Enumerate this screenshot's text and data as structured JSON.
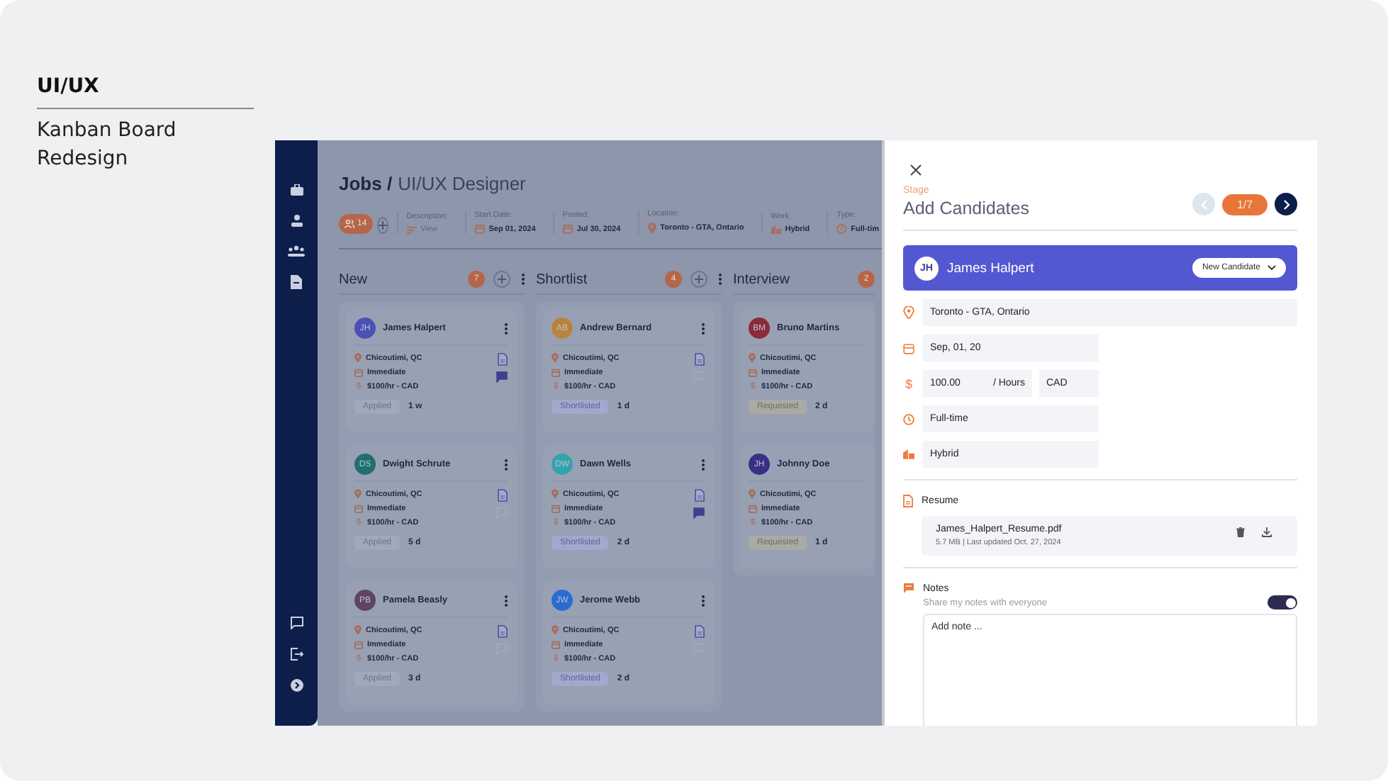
{
  "case_study": {
    "category": "UI/UX",
    "title": "Kanban Board Redesign"
  },
  "job": {
    "breadcrumb": "Jobs /",
    "title": "UI/UX Designer",
    "candidate_count": "14",
    "meta": [
      {
        "kind": "description",
        "label": "Description:",
        "value": "View"
      },
      {
        "kind": "date",
        "label": "Start Date:",
        "value": "Sep 01, 2024"
      },
      {
        "kind": "date",
        "label": "Posted:",
        "value": "Jul 30, 2024"
      },
      {
        "kind": "location",
        "label": "Location:",
        "value": "Toronto - GTA, Ontario"
      },
      {
        "kind": "work",
        "label": "Work:",
        "value": "Hybrid"
      },
      {
        "kind": "type",
        "label": "Type:",
        "value": "Full-tim"
      }
    ]
  },
  "columns": [
    {
      "title": "New",
      "count": "7",
      "cards": [
        {
          "initials": "JH",
          "name": "James Halpert",
          "color": "#4b50b4",
          "location": "Chicoutimi, QC",
          "availability": "Immediate",
          "rate_symbol": "$",
          "rate": "$100/hr - CAD",
          "status": {
            "kind": "applied",
            "text": "Applied"
          },
          "age": "1 w",
          "notes": true
        },
        {
          "initials": "DS",
          "name": "Dwight Schrute",
          "color": "#1f6f6e",
          "location": "Chicoutimi, QC",
          "availability": "Immediate",
          "rate_symbol": "$",
          "rate": "$100/hr - CAD",
          "status": {
            "kind": "applied",
            "text": "Applied"
          },
          "age": "5 d",
          "notes": false
        },
        {
          "initials": "PB",
          "name": "Pamela Beasly",
          "color": "#5e4560",
          "location": "Chicoutimi, QC",
          "availability": "Immediate",
          "rate_symbol": "$",
          "rate": "$100/hr - CAD",
          "status": {
            "kind": "applied",
            "text": "Applied"
          },
          "age": "3 d",
          "notes": false
        }
      ]
    },
    {
      "title": "Shortlist",
      "count": "4",
      "cards": [
        {
          "initials": "AB",
          "name": "Andrew Bernard",
          "color": "#b9843a",
          "location": "Chicoutimi, QC",
          "availability": "Immediate",
          "rate_symbol": "$",
          "rate": "$100/hr - CAD",
          "status": {
            "kind": "shortlisted",
            "text": "Shortlisted"
          },
          "age": "1 d",
          "notes": false
        },
        {
          "initials": "DW",
          "name": "Dawn Wells",
          "color": "#35a3ad",
          "location": "Chicoutimi, QC",
          "availability": "Immediate",
          "rate_symbol": "$",
          "rate": "$100/hr - CAD",
          "status": {
            "kind": "shortlisted",
            "text": "Shortlisted"
          },
          "age": "2 d",
          "notes": true
        },
        {
          "initials": "JW",
          "name": "Jerome Webb",
          "color": "#2a6bd0",
          "location": "Chicoutimi, QC",
          "availability": "Immediate",
          "rate_symbol": "$",
          "rate": "$100/hr - CAD",
          "status": {
            "kind": "shortlisted",
            "text": "Shortlisted"
          },
          "age": "2 d",
          "notes": false
        }
      ]
    },
    {
      "title": "Interview",
      "count": "2",
      "cards": [
        {
          "initials": "BM",
          "name": "Bruno Martins",
          "color": "#8c2a38",
          "location": "Chicoutimi, QC",
          "availability": "Immediate",
          "rate_symbol": "$",
          "rate": "$100/hr - CAD",
          "status": {
            "kind": "requested",
            "text": "Requested"
          },
          "age": "2 d"
        },
        {
          "initials": "JH",
          "name": "Johnny Doe",
          "color": "#3a2f86",
          "location": "Chicoutimi, QC",
          "availability": "Immediate",
          "rate_symbol": "$",
          "rate": "$100/hr - CAD",
          "status": {
            "kind": "requested",
            "text": "Requested"
          },
          "age": "1 d"
        }
      ]
    }
  ],
  "panel": {
    "stage_label": "Stage",
    "title": "Add Candidates",
    "page": "1/7",
    "prev_disabled": true,
    "candidate": {
      "initials": "JH",
      "name": "James Halpert",
      "status": "New Candidate"
    },
    "location": "Toronto - GTA, Ontario",
    "start": "Sep, 01, 20",
    "rate_symbol": "$",
    "rate": "100.00",
    "rate_unit": "/ Hours",
    "currency": "CAD",
    "type": "Full-time",
    "work": "Hybrid",
    "resume": {
      "label": "Resume",
      "file": "James_Halpert_Resume.pdf",
      "info": "5.7 MB | Last updated Oct. 27, 2024"
    },
    "notes": {
      "label": "Notes",
      "share_label": "Share my notes with everyone",
      "share_on": true,
      "placeholder": "Add note ..."
    }
  }
}
